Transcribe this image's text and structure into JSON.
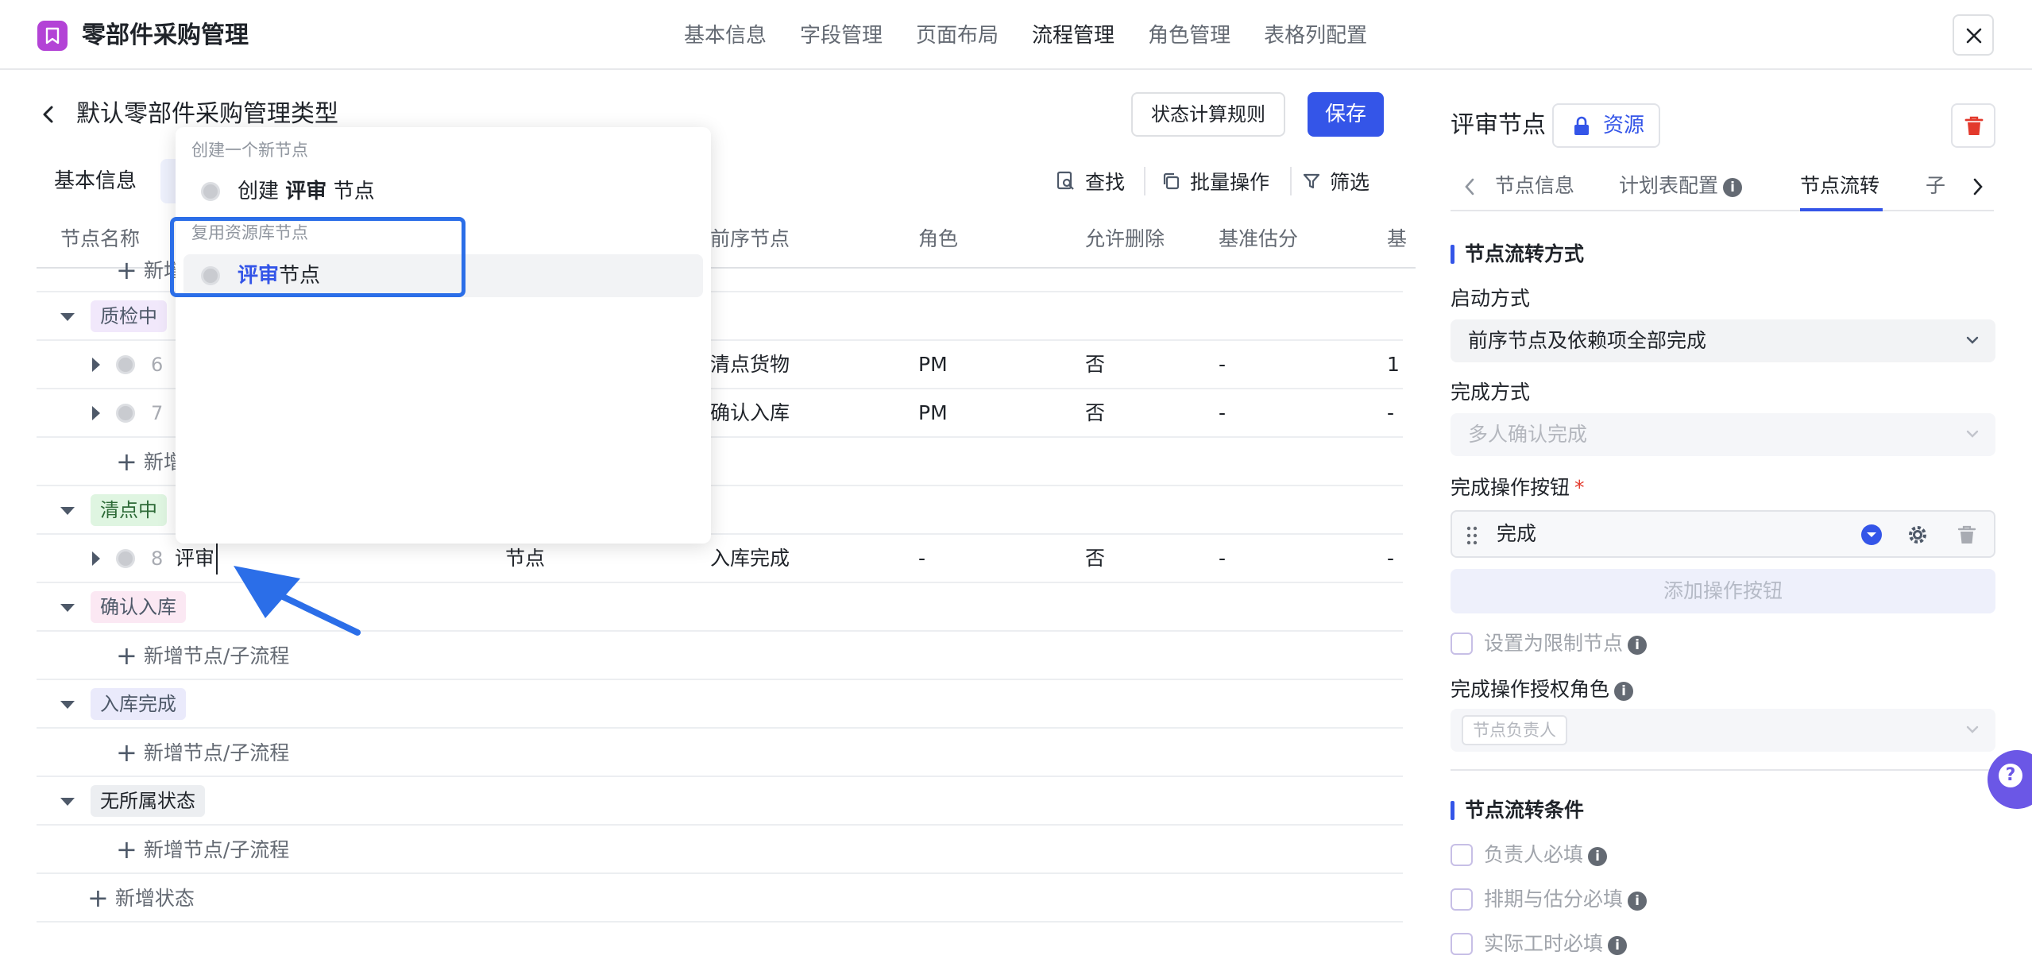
{
  "app": {
    "title": "零部件采购管理",
    "accent": "#3455e8",
    "icon_color": "#b343d6"
  },
  "nav": {
    "items": [
      "基本信息",
      "字段管理",
      "页面布局",
      "流程管理",
      "角色管理",
      "表格列配置"
    ],
    "active": "流程管理"
  },
  "page": {
    "title": "默认零部件采购管理类型",
    "btn_rule": "状态计算规则",
    "btn_save": "保存",
    "tab_basic": "基本信息"
  },
  "toolbar": {
    "find": "查找",
    "batch": "批量操作",
    "filter": "筛选"
  },
  "table": {
    "headers": [
      "节点名称",
      "前序节点",
      "角色",
      "允许删除",
      "基准估分",
      "基"
    ],
    "groups": [
      {
        "status": "质检中",
        "rows": [
          {
            "num": "6",
            "prev": "清点货物",
            "role": "PM",
            "deletable": "否",
            "est": "-",
            "extra": "1"
          },
          {
            "num": "7",
            "prev": "确认入库",
            "role": "PM",
            "deletable": "否",
            "est": "-",
            "extra": "-"
          }
        ],
        "add_partial": "新增"
      },
      {
        "status": "清点中",
        "rows": [
          {
            "num": "8",
            "name": "评审",
            "type": "节点",
            "prev": "入库完成",
            "role": "-",
            "deletable": "否",
            "est": "-",
            "extra": "-"
          }
        ]
      },
      {
        "status": "确认入库",
        "add": "新增节点/子流程"
      },
      {
        "status": "入库完成",
        "add": "新增节点/子流程"
      },
      {
        "status": "无所属状态",
        "add": "新增节点/子流程"
      }
    ],
    "add_state": "新增状态"
  },
  "dropdown": {
    "group_create": "创建一个新节点",
    "create_prefix": "创建",
    "create_keyword": "评审",
    "create_suffix": "节点",
    "group_reuse": "复用资源库节点",
    "reuse_keyword": "评审",
    "reuse_suffix": "节点"
  },
  "panel": {
    "title": "评审节点",
    "resource_btn": "资源",
    "tabs": [
      "节点信息",
      "计划表配置",
      "节点流转",
      "子"
    ],
    "active_tab": "节点流转",
    "section1": "节点流转方式",
    "start_label": "启动方式",
    "start_value": "前序节点及依赖项全部完成",
    "complete_label": "完成方式",
    "complete_value": "多人确认完成",
    "op_label": "完成操作按钮",
    "op_required": "*",
    "op_value": "完成",
    "add_op": "添加操作按钮",
    "restrict_label": "设置为限制节点",
    "auth_label": "完成操作授权角色",
    "auth_chip": "节点负责人",
    "section2": "节点流转条件",
    "cond1": "负责人必填",
    "cond2": "排期与估分必填",
    "cond3": "实际工时必填"
  }
}
